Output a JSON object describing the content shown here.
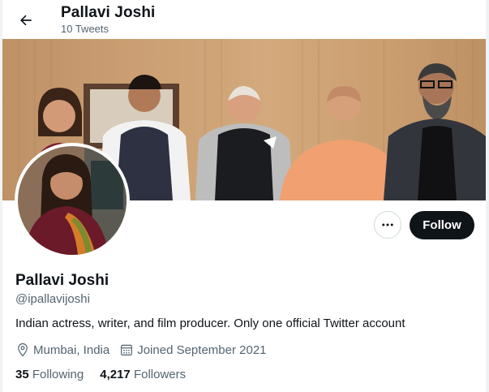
{
  "header": {
    "name": "Pallavi Joshi",
    "tweet_count": "10 Tweets"
  },
  "icons": {
    "back": "back-arrow-icon",
    "more": "more-dots-icon",
    "location": "location-pin-icon",
    "calendar": "calendar-icon"
  },
  "actions": {
    "follow_label": "Follow"
  },
  "profile": {
    "display_name": "Pallavi Joshi",
    "handle": "@ipallavijoshi",
    "bio": "Indian actress, writer, and film producer. Only one official Twitter account",
    "location": "Mumbai, India",
    "joined": "Joined September 2021"
  },
  "stats": {
    "following_count": "35",
    "following_label": "Following",
    "followers_count": "4,217",
    "followers_label": "Followers"
  },
  "colors": {
    "follow_bg": "#0f1419",
    "secondary_text": "#536471",
    "border": "#cfd9de"
  }
}
